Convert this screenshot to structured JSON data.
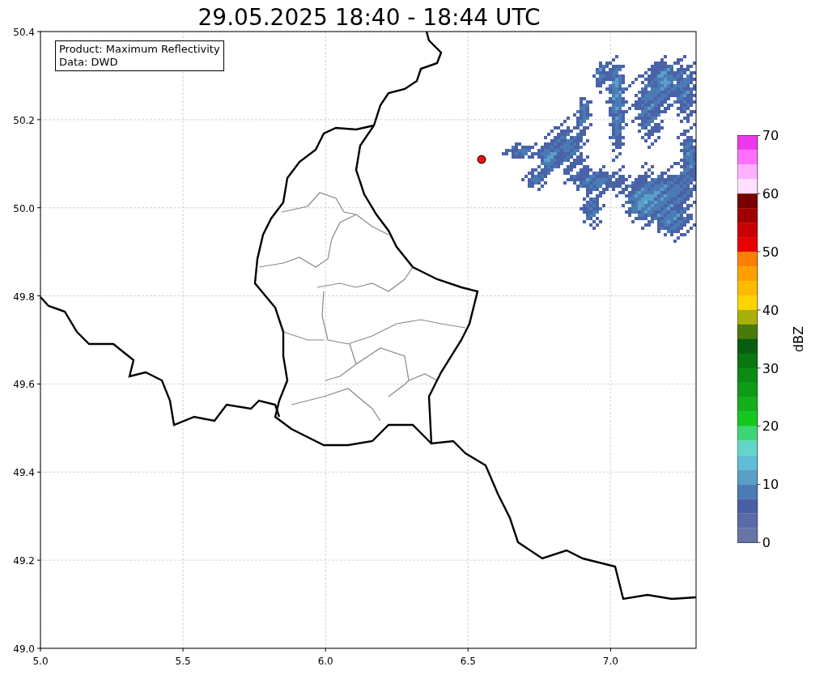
{
  "title": "29.05.2025 18:40 - 18:44 UTC",
  "info_box": [
    "Product: Maximum Reflectivity",
    "Data: DWD"
  ],
  "map": {
    "xticks": [
      "5.0",
      "5.5",
      "6.0",
      "6.5",
      "7.0"
    ],
    "yticks": [
      "50.4",
      "50.2",
      "50.0",
      "49.8",
      "49.6",
      "49.4",
      "49.2",
      "49.0"
    ]
  },
  "colorbar": {
    "label": "dBZ",
    "ticks": [
      "70",
      "60",
      "50",
      "40",
      "30",
      "20",
      "10",
      "0"
    ],
    "bins": [
      {
        "color": "#ee38ee"
      },
      {
        "color": "#ff70ff"
      },
      {
        "color": "#ffb0ff"
      },
      {
        "color": "#ffe0ff"
      },
      {
        "color": "#780000"
      },
      {
        "color": "#a00000"
      },
      {
        "color": "#c80000"
      },
      {
        "color": "#e60000"
      },
      {
        "color": "#ff7f00"
      },
      {
        "color": "#ff9f00"
      },
      {
        "color": "#ffbb00"
      },
      {
        "color": "#ffd400"
      },
      {
        "color": "#a8b00a"
      },
      {
        "color": "#4a7a0a"
      },
      {
        "color": "#085e0e"
      },
      {
        "color": "#0a7612"
      },
      {
        "color": "#0b8a14"
      },
      {
        "color": "#0e9c18"
      },
      {
        "color": "#12b01a"
      },
      {
        "color": "#14c81e"
      },
      {
        "color": "#3dd676"
      },
      {
        "color": "#62d7c8"
      },
      {
        "color": "#5fbdd8"
      },
      {
        "color": "#5a9fc8"
      },
      {
        "color": "#4a7bb4"
      },
      {
        "color": "#4a60a6"
      },
      {
        "color": "#5a6aa8"
      },
      {
        "color": "#6674a6"
      }
    ]
  }
}
